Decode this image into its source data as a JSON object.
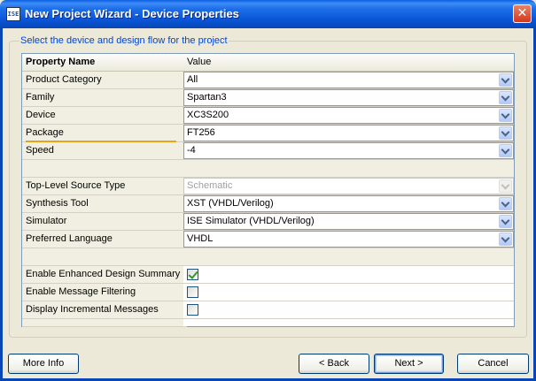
{
  "window": {
    "app_icon": "ISE",
    "title": "New Project Wizard - Device Properties"
  },
  "caption": "Select the device and design flow for the project",
  "grid": {
    "header": {
      "name": "Property Name",
      "value": "Value"
    },
    "rows": [
      {
        "name": "Product Category",
        "value": "All",
        "kind": "combo"
      },
      {
        "name": "Family",
        "value": "Spartan3",
        "kind": "combo"
      },
      {
        "name": "Device",
        "value": "XC3S200",
        "kind": "combo"
      },
      {
        "name": "Package",
        "value": "FT256",
        "kind": "combo"
      },
      {
        "name": "Speed",
        "value": "-4",
        "kind": "combo"
      },
      {
        "name": "Top-Level Source Type",
        "value": "Schematic",
        "kind": "combo-disabled"
      },
      {
        "name": "Synthesis Tool",
        "value": "XST (VHDL/Verilog)",
        "kind": "combo"
      },
      {
        "name": "Simulator",
        "value": "ISE Simulator (VHDL/Verilog)",
        "kind": "combo"
      },
      {
        "name": "Preferred Language",
        "value": "VHDL",
        "kind": "combo"
      },
      {
        "name": "Enable Enhanced Design Summary",
        "checked": true,
        "kind": "checkbox"
      },
      {
        "name": "Enable Message Filtering",
        "checked": false,
        "kind": "checkbox"
      },
      {
        "name": "Display Incremental Messages",
        "checked": false,
        "kind": "checkbox"
      }
    ]
  },
  "buttons": {
    "more_info": "More Info",
    "back": "< Back",
    "next": "Next >",
    "cancel": "Cancel"
  },
  "icons": {
    "close": "close-icon",
    "dropdown": "chevron-down-icon",
    "checkmark": "check-icon"
  },
  "colors": {
    "title_bar": "#0955d8",
    "caption_text": "#0046d5",
    "focus_underline": "#e8a317"
  }
}
